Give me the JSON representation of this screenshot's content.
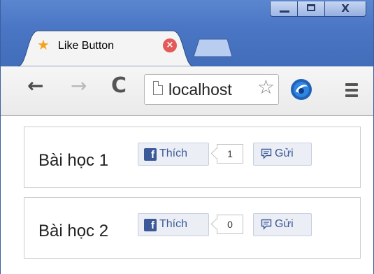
{
  "window": {
    "tab_title": "Like Button",
    "tab_icon": "star-icon",
    "close_symbol": "X"
  },
  "toolbar": {
    "address": "localhost",
    "icons": [
      "back-arrow-icon",
      "forward-arrow-icon",
      "reload-icon",
      "page-icon",
      "bookmark-star-icon",
      "extension-icon",
      "menu-icon"
    ]
  },
  "lessons": [
    {
      "title": "Bài học 1",
      "like_label": "Thích",
      "like_count": "1",
      "send_label": "Gửi"
    },
    {
      "title": "Bài học 2",
      "like_label": "Thích",
      "like_count": "0",
      "send_label": "Gửi"
    }
  ],
  "colors": {
    "facebook_blue": "#3b5998",
    "button_bg": "#eceef5",
    "titlebar": "#4a76c5"
  }
}
